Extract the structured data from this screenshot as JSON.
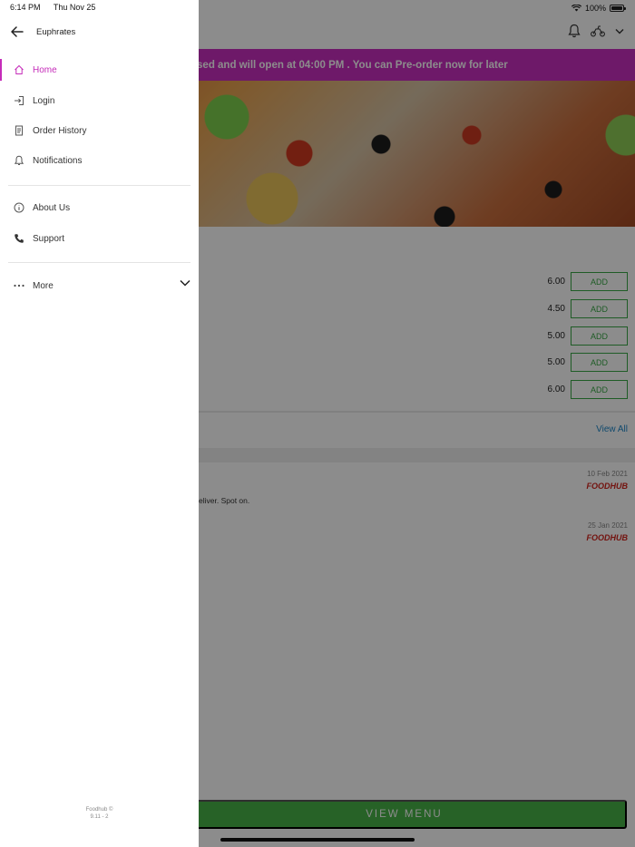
{
  "status_bar": {
    "time": "6:14 PM",
    "date": "Thu Nov 25",
    "battery": "100%"
  },
  "drawer": {
    "restaurant_name": "Euphrates",
    "nav": [
      {
        "label": "Home",
        "icon": "home-icon",
        "active": true
      },
      {
        "label": "Login",
        "icon": "login-icon"
      },
      {
        "label": "Order History",
        "icon": "receipt-icon"
      },
      {
        "label": "Notifications",
        "icon": "bell-icon"
      }
    ],
    "secondary": [
      {
        "label": "About Us",
        "icon": "info-icon"
      },
      {
        "label": "Support",
        "icon": "phone-icon"
      }
    ],
    "more_label": "More",
    "footer_brand": "Foodhub ©",
    "footer_version": "9.11 - 2"
  },
  "banner": {
    "text": "osed and will open at 04:00 PM . You can Pre-order now for later"
  },
  "menu_items": [
    {
      "price": "6.00",
      "button": "ADD"
    },
    {
      "price": "4.50",
      "button": "ADD"
    },
    {
      "price": "5.00",
      "button": "ADD"
    },
    {
      "price": "5.00",
      "button": "ADD"
    },
    {
      "price": "6.00",
      "button": "ADD"
    }
  ],
  "view_all": "View All",
  "reviews": [
    {
      "date": "10 Feb 2021",
      "source": "FOODHUB",
      "text": "eliver. Spot on."
    },
    {
      "date": "25 Jan 2021",
      "source": "FOODHUB",
      "text": ""
    }
  ],
  "view_menu_label": "VIEW MENU",
  "colors": {
    "brand": "#c52cb9",
    "banner": "#c82fc0",
    "cta": "#48b348",
    "add": "#39a846",
    "link": "#1d86c7"
  }
}
